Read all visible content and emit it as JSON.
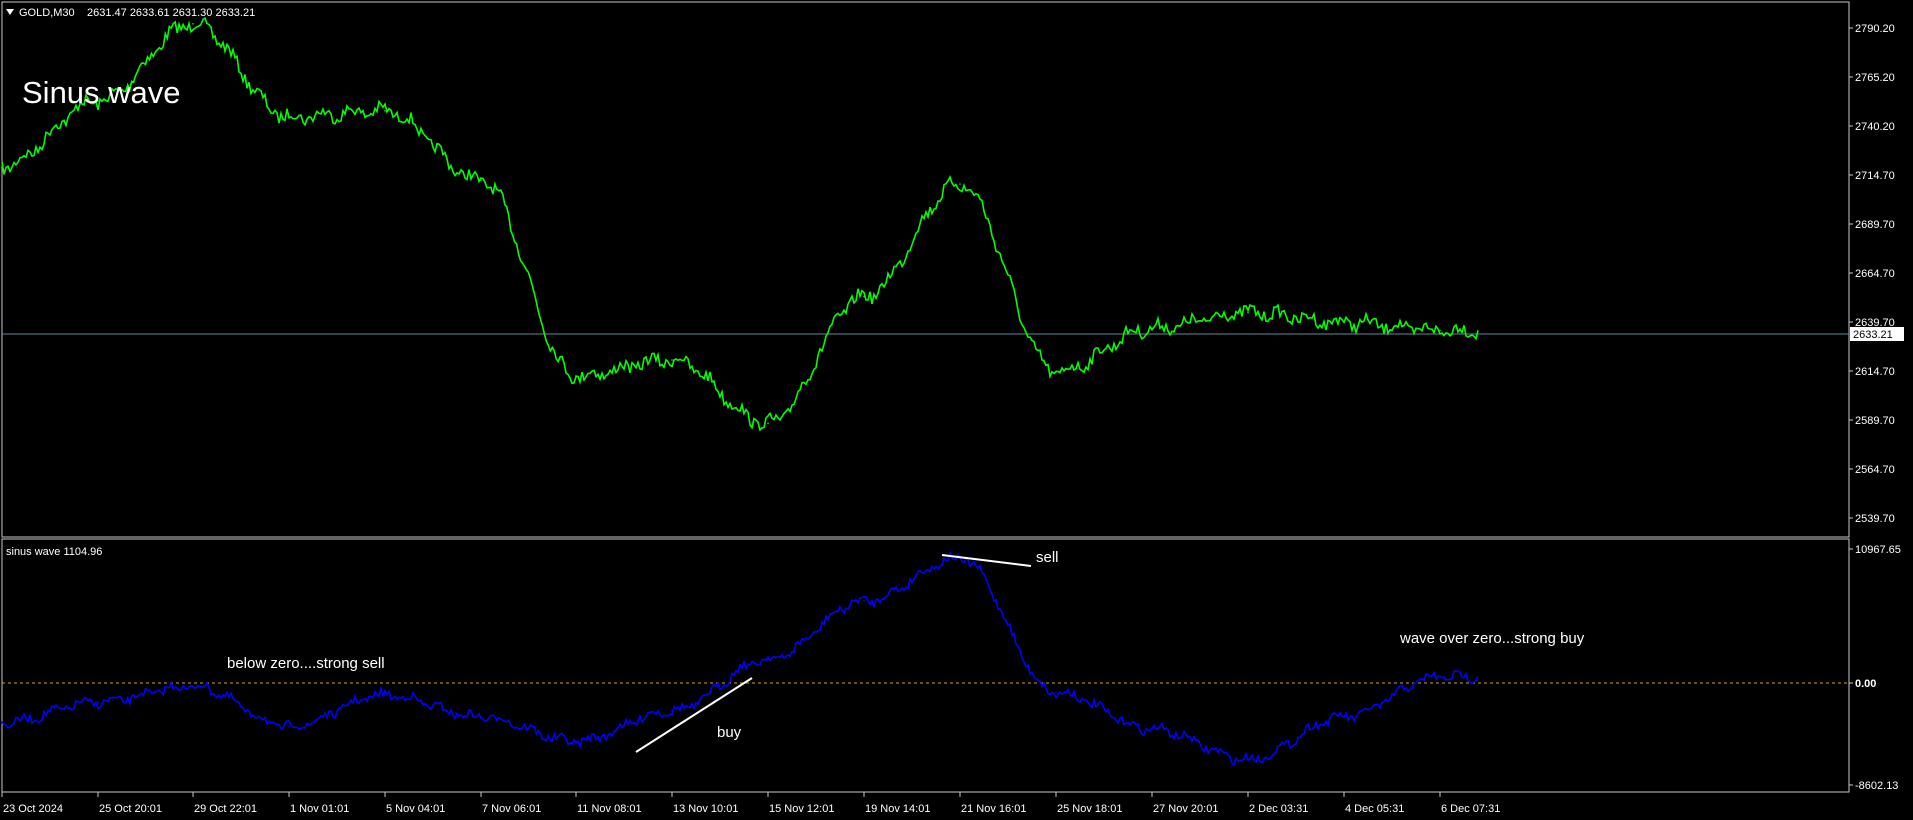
{
  "header": {
    "symbol": "GOLD,M30",
    "ohlc": "2631.47 2633.61 2631.30 2633.21",
    "big_title": "Sinus wave"
  },
  "main": {
    "price_axis": [
      "2790.20",
      "2765.20",
      "2740.20",
      "2714.70",
      "2689.70",
      "2664.70",
      "2639.70",
      "2614.70",
      "2589.70",
      "2564.70",
      "2539.70"
    ],
    "current_price_label": "2633.21"
  },
  "indicator": {
    "label": "sinus wave 1104.96",
    "axis": [
      "10967.65",
      "0.00",
      "-8602.13"
    ],
    "annotations": {
      "sell_zero": "below zero....strong sell",
      "buy": "buy",
      "sell": "sell",
      "buy_zero": "wave over zero...strong buy"
    }
  },
  "time_axis": [
    "23 Oct 2024",
    "25 Oct 20:01",
    "29 Oct 22:01",
    "1 Nov 01:01",
    "5 Nov 04:01",
    "7 Nov 06:01",
    "11 Nov 08:01",
    "13 Nov 10:01",
    "15 Nov 12:01",
    "19 Nov 14:01",
    "21 Nov 16:01",
    "25 Nov 18:01",
    "27 Nov 20:01",
    "2 Dec 03:31",
    "4 Dec 05:31",
    "6 Dec 07:31"
  ],
  "colors": {
    "background": "#000000",
    "price_line": "#00ff00",
    "indicator_line": "#0000ff",
    "zero_line": "#d4a017",
    "border": "#ffffff",
    "current_price_line": "#5f8a9a"
  },
  "chart_data": {
    "type": "line",
    "price_series": {
      "x": [
        "23 Oct 2024",
        "25 Oct 20:01",
        "29 Oct 22:01",
        "1 Nov 01:01",
        "5 Nov 04:01",
        "7 Nov 06:01",
        "11 Nov 08:01",
        "13 Nov 10:01",
        "15 Nov 12:01",
        "19 Nov 14:01",
        "21 Nov 16:01",
        "25 Nov 18:01",
        "27 Nov 20:01",
        "2 Dec 03:31",
        "4 Dec 05:31",
        "6 Dec 07:31"
      ],
      "values": [
        2716,
        2749,
        2788,
        2741,
        2744,
        2709,
        2610,
        2618,
        2586,
        2650,
        2707,
        2612,
        2634,
        2642,
        2637,
        2633
      ],
      "ylim": [
        2532,
        2796
      ]
    },
    "indicator_series": {
      "x": [
        "23 Oct 2024",
        "25 Oct 20:01",
        "29 Oct 22:01",
        "1 Nov 01:01",
        "5 Nov 04:01",
        "7 Nov 06:01",
        "11 Nov 08:01",
        "13 Nov 10:01",
        "15 Nov 12:01",
        "19 Nov 14:01",
        "21 Nov 16:01",
        "25 Nov 18:01",
        "27 Nov 20:01",
        "2 Dec 03:31",
        "4 Dec 05:31",
        "6 Dec 07:31"
      ],
      "values": [
        -3500,
        -1800,
        -500,
        -3800,
        -1200,
        -3000,
        -5000,
        -2500,
        1700,
        6500,
        10000,
        -1000,
        -4000,
        -6500,
        -3000,
        300
      ],
      "ylim": [
        -9000,
        11500
      ]
    }
  }
}
